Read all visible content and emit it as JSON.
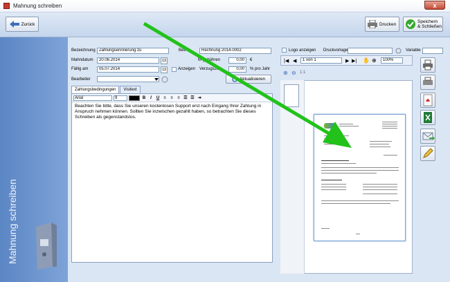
{
  "window": {
    "title": "Mahnung schreiben",
    "close_glyph": "x"
  },
  "toolbar": {
    "back_label": "Zurück",
    "print_label": "Drucken",
    "save_label_1": "Speichern",
    "save_label_2": "& Schließen"
  },
  "side": {
    "vertical_title": "Mahnung schreiben"
  },
  "form": {
    "bezeichnung_label": "Bezeichnung",
    "bezeichnung_value": "Zahlungserinnerung zu",
    "betreff_label": "Betre",
    "betreff_value": "Rechnung 2014-0002",
    "mahndatum_label": "Mahndatum",
    "mahndatum_value": "20.06.2014",
    "faellig_label": "Fällig am",
    "faellig_value": "05.07.2014",
    "anzeigen_label": "Anzeigen",
    "spesen_label": "M    gebühren",
    "spesen_value": "0,00",
    "spesen_unit": "€",
    "zinsen_label": "Verzugszins",
    "zinsen_value": "0,00",
    "zinsen_unit": "% pro Jahr",
    "bearbeiter_label": "Bearbeiter",
    "aktualisieren_label": "Aktualisieren",
    "cal_glyph": "13"
  },
  "tabs": [
    {
      "label": "Zahlungsbedingungen"
    },
    {
      "label": "Visitext"
    }
  ],
  "editor": {
    "font": "Arial",
    "size": "9",
    "bold": "B",
    "italic": "I",
    "underline": "U",
    "text": "Beachten Sie bitte, dass Sie unseren kostenlosen Support erst nach Eingang Ihrer Zahlung in Anspruch nehmen können. Sollten Sie inzwischen gezahlt haben, so betrachten Sie dieses Schreiben als gegenstandslos."
  },
  "preview": {
    "logo_label": "Logo anzeigen",
    "druckvorlage_label": "Druckvorlage",
    "variable_label": "Variable",
    "page_value": "1 von 1",
    "zoom_value": "100%",
    "ratio_label": "1:1"
  },
  "colors": {
    "accent": "#4a79c0",
    "arrow": "#22c21a"
  }
}
